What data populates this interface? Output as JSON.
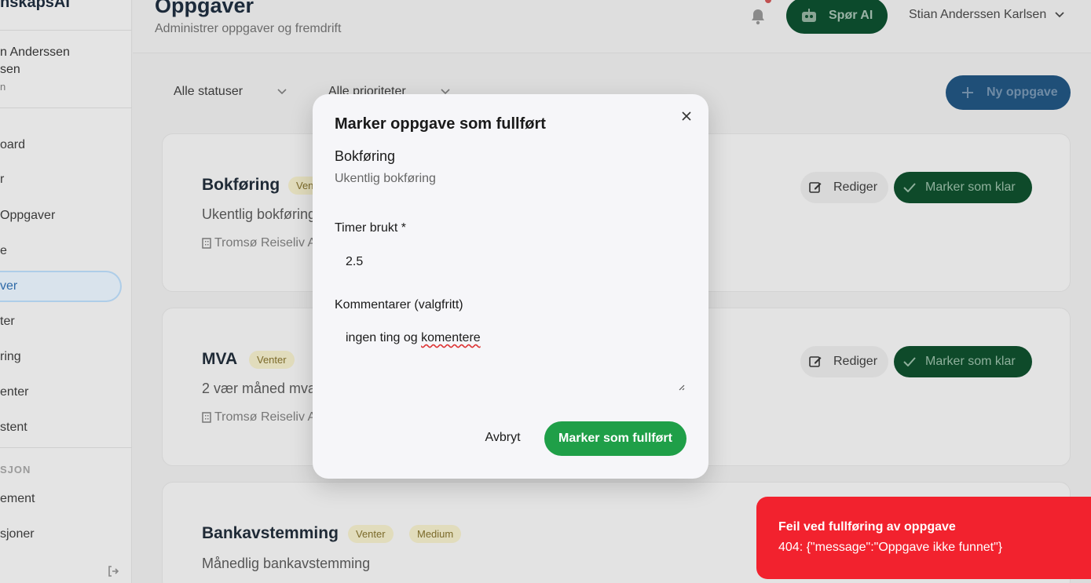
{
  "sidebar": {
    "brand": "nskapsAI",
    "user_name_line1": "n Anderssen",
    "user_name_line2": "sen",
    "user_role": "n",
    "items": [
      {
        "label": "oard"
      },
      {
        "label": "r"
      },
      {
        "label": "Oppgaver"
      },
      {
        "label": "e"
      },
      {
        "label": "ver"
      },
      {
        "label": "ter"
      },
      {
        "label": "ring"
      },
      {
        "label": "enter"
      },
      {
        "label": "stent"
      }
    ],
    "section_label": "SJON",
    "section_items": [
      {
        "label": "ement"
      },
      {
        "label": "sjoner"
      }
    ]
  },
  "header": {
    "title": "Oppgaver",
    "subtitle": "Administrer oppgaver og fremdrift",
    "ask_ai_label": "Spør AI",
    "user_name": "Stian Anderssen Karlsen"
  },
  "filters": {
    "status": "Alle statuser",
    "priority": "Alle prioriteter"
  },
  "toolbar": {
    "new_task_label": "Ny oppgave"
  },
  "tasks": [
    {
      "title": "Bokføring",
      "status": "Venter",
      "priority": "",
      "description": "Ukentlig bokføring",
      "client": "Tromsø Reiseliv AS",
      "edit_label": "Rediger",
      "done_label": "Marker som klar"
    },
    {
      "title": "MVA",
      "status": "Venter",
      "priority": "",
      "description": "2 vær måned mva",
      "client": "Tromsø Reiseliv AS",
      "edit_label": "Rediger",
      "done_label": "Marker som klar"
    },
    {
      "title": "Bankavstemming",
      "status": "Venter",
      "priority": "Medium",
      "description": "Månedlig bankavstemming",
      "client": "",
      "edit_label": "",
      "done_label": ""
    }
  ],
  "modal": {
    "title": "Marker oppgave som fullført",
    "task_name": "Bokføring",
    "task_description": "Ukentlig bokføring",
    "hours_label": "Timer brukt *",
    "hours_value": "2.5",
    "comments_label": "Kommentarer (valgfritt)",
    "comments_value_part1": "ingen ting og ",
    "comments_value_misspelled": "komentere",
    "cancel_label": "Avbryt",
    "confirm_label": "Marker som fullført"
  },
  "toast": {
    "title": "Feil ved fullføring av oppgave",
    "message": "404: {\"message\":\"Oppgave ikke funnet\"}"
  },
  "colors": {
    "primary_green": "#1f9f48",
    "error_red": "#f2222e",
    "primary_blue": "#1f4f78"
  }
}
